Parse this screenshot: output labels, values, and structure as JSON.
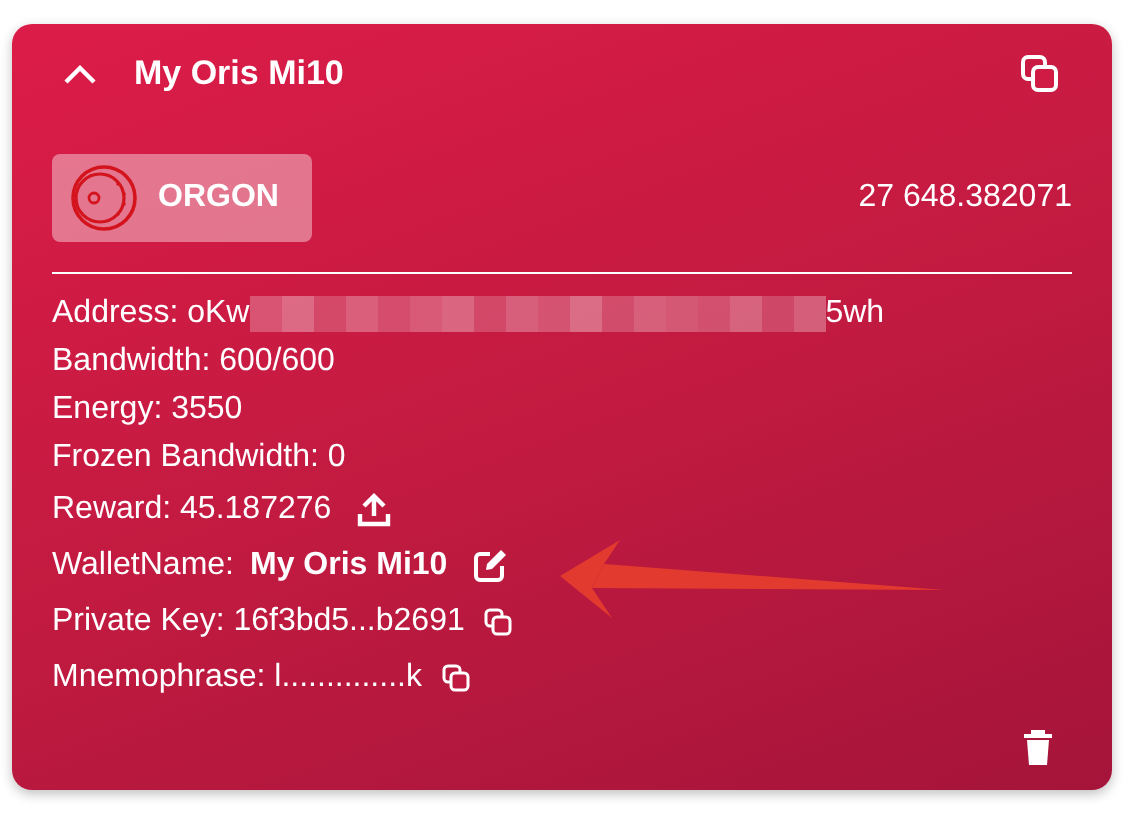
{
  "header": {
    "title": "My Oris Mi10",
    "expanded": true
  },
  "token": {
    "name": "ORGON",
    "balance": "27 648.382071"
  },
  "address": {
    "label": "Address:",
    "start": "oKw",
    "end": "5wh"
  },
  "details": [
    {
      "kind": "plain",
      "text": "Bandwidth: 600/600"
    },
    {
      "kind": "plain",
      "text": "Energy: 3550"
    },
    {
      "kind": "plain",
      "text": "Frozen Bandwidth: 0"
    },
    {
      "kind": "upload",
      "text": "Reward: 45.187276"
    },
    {
      "kind": "edit",
      "label": "WalletName:",
      "value": "My Oris Mi10"
    },
    {
      "kind": "copy",
      "text": "Private Key: 16f3bd5...b2691"
    },
    {
      "kind": "copy",
      "text": "Mnemophrase: l..............k"
    }
  ]
}
